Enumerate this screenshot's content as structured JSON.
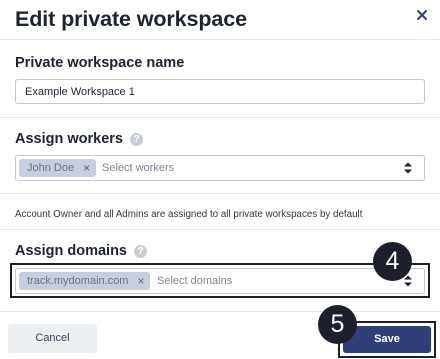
{
  "dialog": {
    "title": "Edit private workspace",
    "close_icon": "close-icon"
  },
  "name_field": {
    "label": "Private workspace name",
    "value": "Example Workspace 1"
  },
  "workers_field": {
    "label": "Assign workers",
    "help_icon": "help-icon",
    "help_glyph": "?",
    "chips": [
      {
        "label": "John Doe"
      }
    ],
    "chip_remove_glyph": "×",
    "placeholder": "Select workers"
  },
  "note": "Account Owner and all Admins are assigned to all private workspaces by default",
  "domains_field": {
    "label": "Assign domains",
    "help_icon": "help-icon",
    "help_glyph": "?",
    "chips": [
      {
        "label": "track.mydomain.com"
      }
    ],
    "chip_remove_glyph": "×",
    "placeholder": "Select domains"
  },
  "steps": {
    "four": "4",
    "five": "5"
  },
  "footer": {
    "cancel_label": "Cancel",
    "save_label": "Save"
  },
  "colors": {
    "accent": "#2f3f7a",
    "chip_bg": "#c6cfdb",
    "step_marker": "#1d1f2d"
  }
}
